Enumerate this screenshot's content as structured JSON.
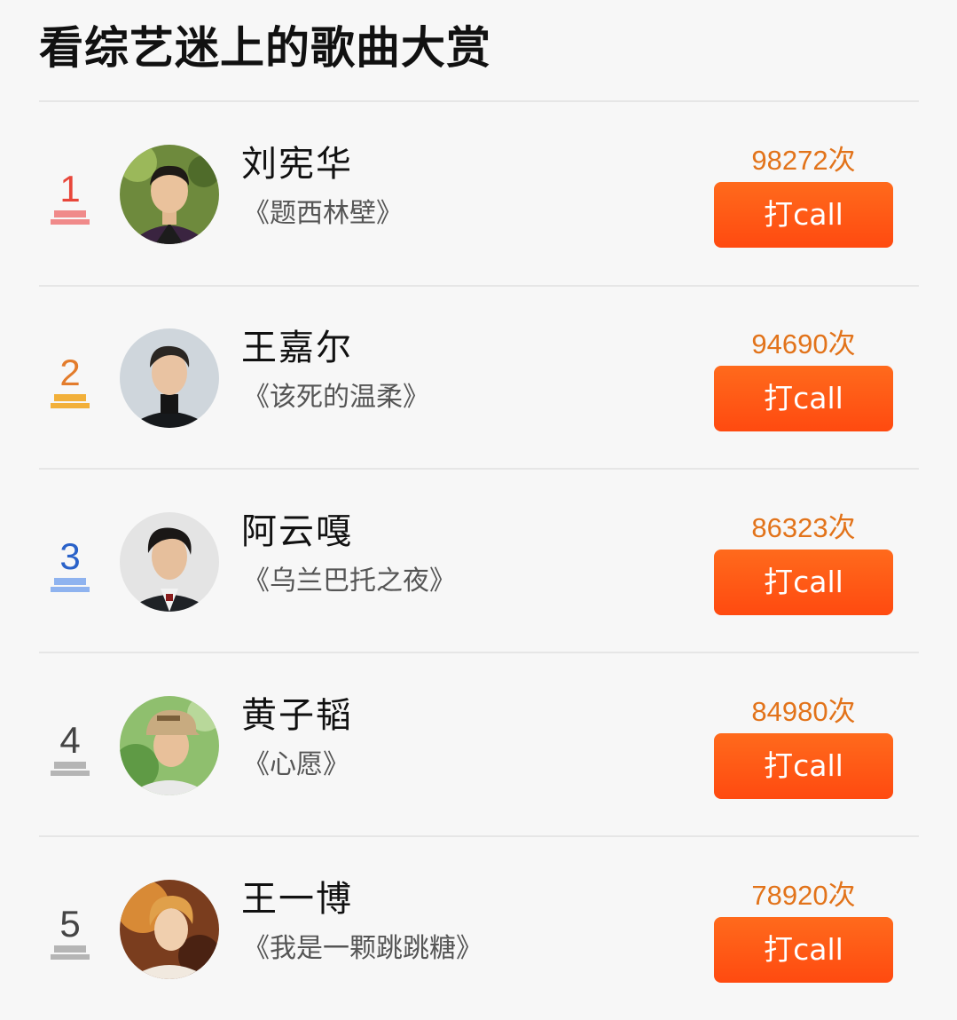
{
  "title": "看综艺迷上的歌曲大赏",
  "colors": {
    "rank1": "#e8463a",
    "rank2": "#e37c2c",
    "rank3": "#2a62c9",
    "rank_other": "#444444",
    "pedestal1": "#f08a8a",
    "pedestal2": "#f2b03a",
    "pedestal3": "#8fb3ef",
    "pedestal_other": "#b5b5b5",
    "votes": "#e2731a",
    "button": "#ff5316"
  },
  "items": [
    {
      "rank": "1",
      "name": "刘宪华",
      "song": "《题西林壁》",
      "votes": "98272次",
      "button": "打call",
      "avatar_icon": "portrait-liu-xianhua"
    },
    {
      "rank": "2",
      "name": "王嘉尔",
      "song": "《该死的温柔》",
      "votes": "94690次",
      "button": "打call",
      "avatar_icon": "portrait-wang-jiaer"
    },
    {
      "rank": "3",
      "name": "阿云嘎",
      "song": "《乌兰巴托之夜》",
      "votes": "86323次",
      "button": "打call",
      "avatar_icon": "portrait-a-yunga"
    },
    {
      "rank": "4",
      "name": "黄子韬",
      "song": "《心愿》",
      "votes": "84980次",
      "button": "打call",
      "avatar_icon": "portrait-huang-zitao"
    },
    {
      "rank": "5",
      "name": "王一博",
      "song": "《我是一颗跳跳糖》",
      "votes": "78920次",
      "button": "打call",
      "avatar_icon": "portrait-wang-yibo"
    }
  ]
}
